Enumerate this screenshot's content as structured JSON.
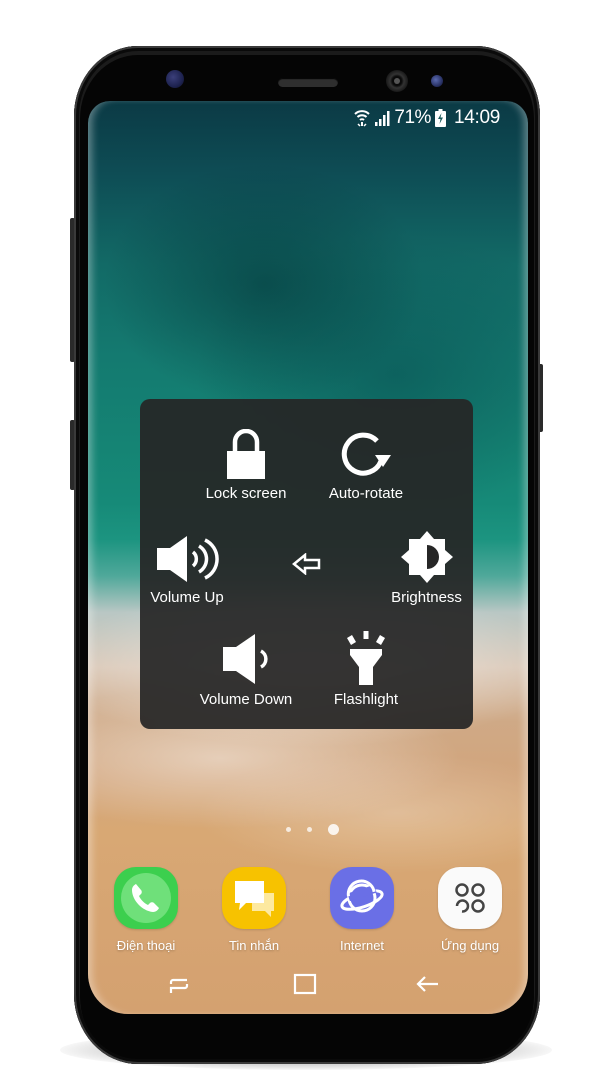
{
  "status_bar": {
    "wifi_icon": "wifi-icon",
    "signal_icon": "cellular-signal-icon",
    "battery_percent": "71%",
    "battery_icon": "battery-charging-icon",
    "time": "14:09"
  },
  "quick_menu": {
    "items": [
      {
        "id": "lock",
        "label": "Lock screen",
        "icon": "lock-icon"
      },
      {
        "id": "rotate",
        "label": "Auto-rotate",
        "icon": "rotate-icon"
      },
      {
        "id": "volup",
        "label": "Volume Up",
        "icon": "volume-up-icon"
      },
      {
        "id": "bright",
        "label": "Brightness",
        "icon": "brightness-icon"
      },
      {
        "id": "voldown",
        "label": "Volume Down",
        "icon": "volume-down-icon"
      },
      {
        "id": "flash",
        "label": "Flashlight",
        "icon": "flashlight-icon"
      }
    ],
    "back_icon": "back-arrow-icon"
  },
  "home_screen": {
    "page_count": 3,
    "active_page": 3
  },
  "dock": {
    "apps": [
      {
        "label": "Điện thoại",
        "icon": "phone-icon",
        "color": "#3ccf4e"
      },
      {
        "label": "Tin nhắn",
        "icon": "messages-icon",
        "color": "#f7c200"
      },
      {
        "label": "Internet",
        "icon": "internet-icon",
        "color": "#6a6fe6"
      },
      {
        "label": "Ứng dụng",
        "icon": "apps-icon",
        "color": "#fafafa"
      }
    ]
  },
  "nav_bar": {
    "recent_icon": "recent-apps-icon",
    "home_icon": "home-icon",
    "back_icon": "back-icon"
  }
}
